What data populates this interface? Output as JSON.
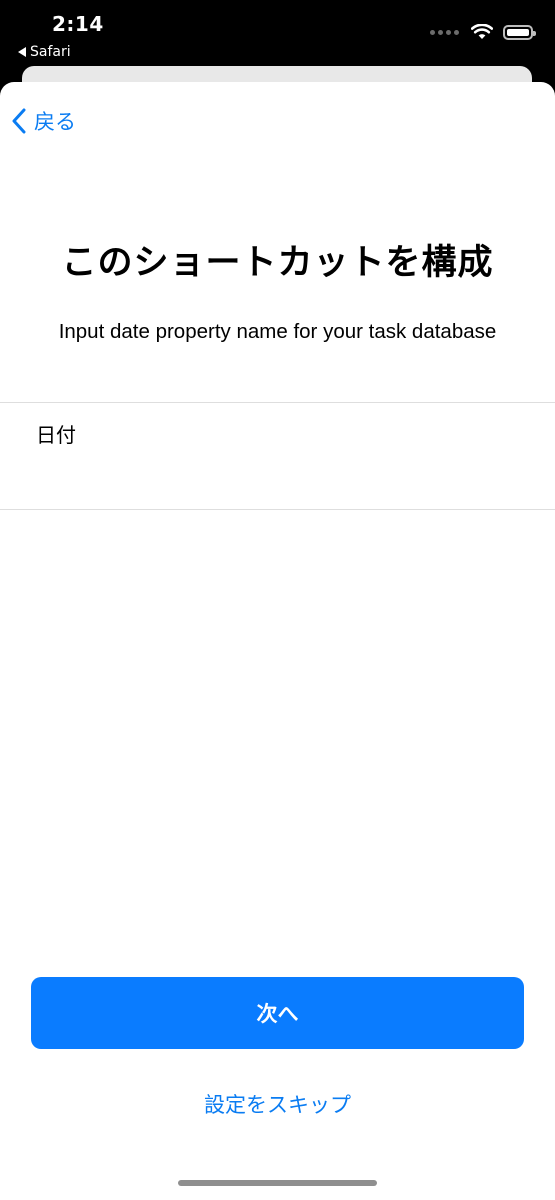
{
  "status_bar": {
    "time": "2:14",
    "back_app": "Safari",
    "icons": [
      "cellular-dots-icon",
      "wifi-icon",
      "battery-icon"
    ]
  },
  "nav": {
    "back_label": "戻る"
  },
  "main": {
    "title": "このショートカットを構成",
    "subtitle": "Input date property name for your task database",
    "field": {
      "value": "日付"
    }
  },
  "footer": {
    "next_label": "次へ",
    "skip_label": "設定をスキップ"
  },
  "colors": {
    "accent": "#0a7cff",
    "link": "#0a7cf2",
    "background": "#ffffff"
  }
}
